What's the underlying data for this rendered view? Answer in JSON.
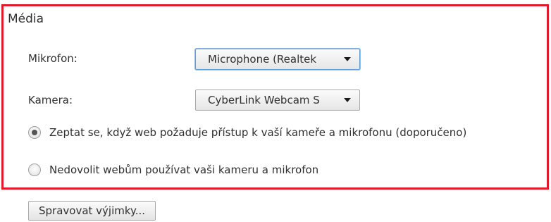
{
  "media": {
    "title": "Média",
    "microphone": {
      "label": "Mikrofon:",
      "selected": "Microphone (Realtek"
    },
    "camera": {
      "label": "Kamera:",
      "selected": "CyberLink Webcam S"
    },
    "radios": [
      {
        "label": "Zeptat se, když web požaduje přístup k vaší kameře a mikrofonu (doporučeno)",
        "checked": true
      },
      {
        "label": "Nedovolit webům používat vaši kameru a mikrofon",
        "checked": false
      }
    ],
    "exceptions_button": "Spravovat výjimky..."
  },
  "colors": {
    "highlight_border": "#e01a2a",
    "focus_ring": "#5b9dd9"
  }
}
